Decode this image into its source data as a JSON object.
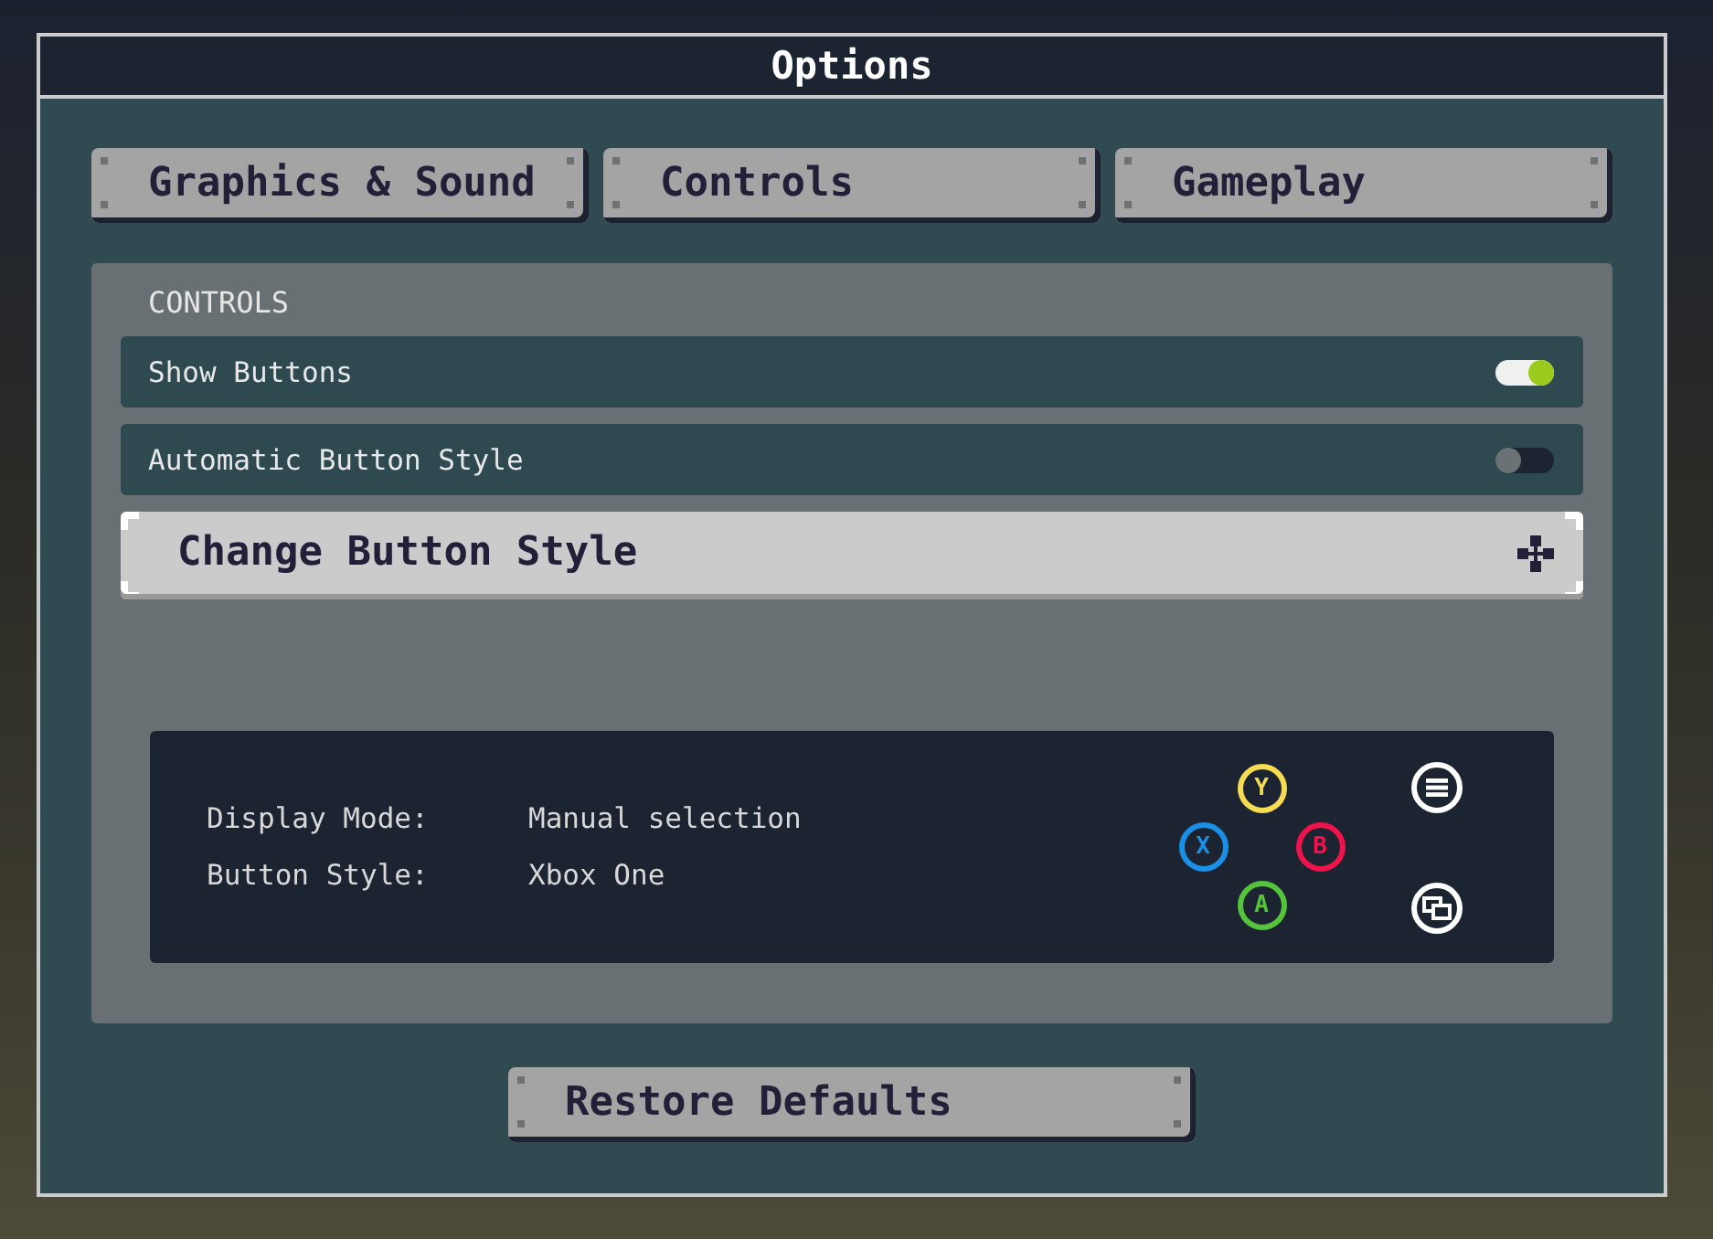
{
  "window": {
    "title": "Options"
  },
  "tabs": [
    {
      "label": "Graphics & Sound"
    },
    {
      "label": "Controls"
    },
    {
      "label": "Gameplay"
    }
  ],
  "controls": {
    "heading": "CONTROLS",
    "rows": [
      {
        "kind": "toggle",
        "label": "Show Buttons",
        "on": true,
        "selected": false
      },
      {
        "kind": "toggle",
        "label": "Automatic Button Style",
        "on": false,
        "selected": false
      },
      {
        "kind": "action",
        "label": "Change Button Style",
        "selected": true
      }
    ]
  },
  "button_style_info": {
    "fields": [
      {
        "label": "Display Mode:",
        "value": "Manual selection"
      },
      {
        "label": "Button Style:",
        "value": "Xbox One"
      }
    ],
    "face_buttons": [
      {
        "label": "Y",
        "color": "#f5dc50"
      },
      {
        "label": "X",
        "color": "#1a8fe6"
      },
      {
        "label": "B",
        "color": "#f0124a"
      },
      {
        "label": "A",
        "color": "#55c43c"
      }
    ]
  },
  "restore_button": {
    "label": "Restore Defaults"
  }
}
